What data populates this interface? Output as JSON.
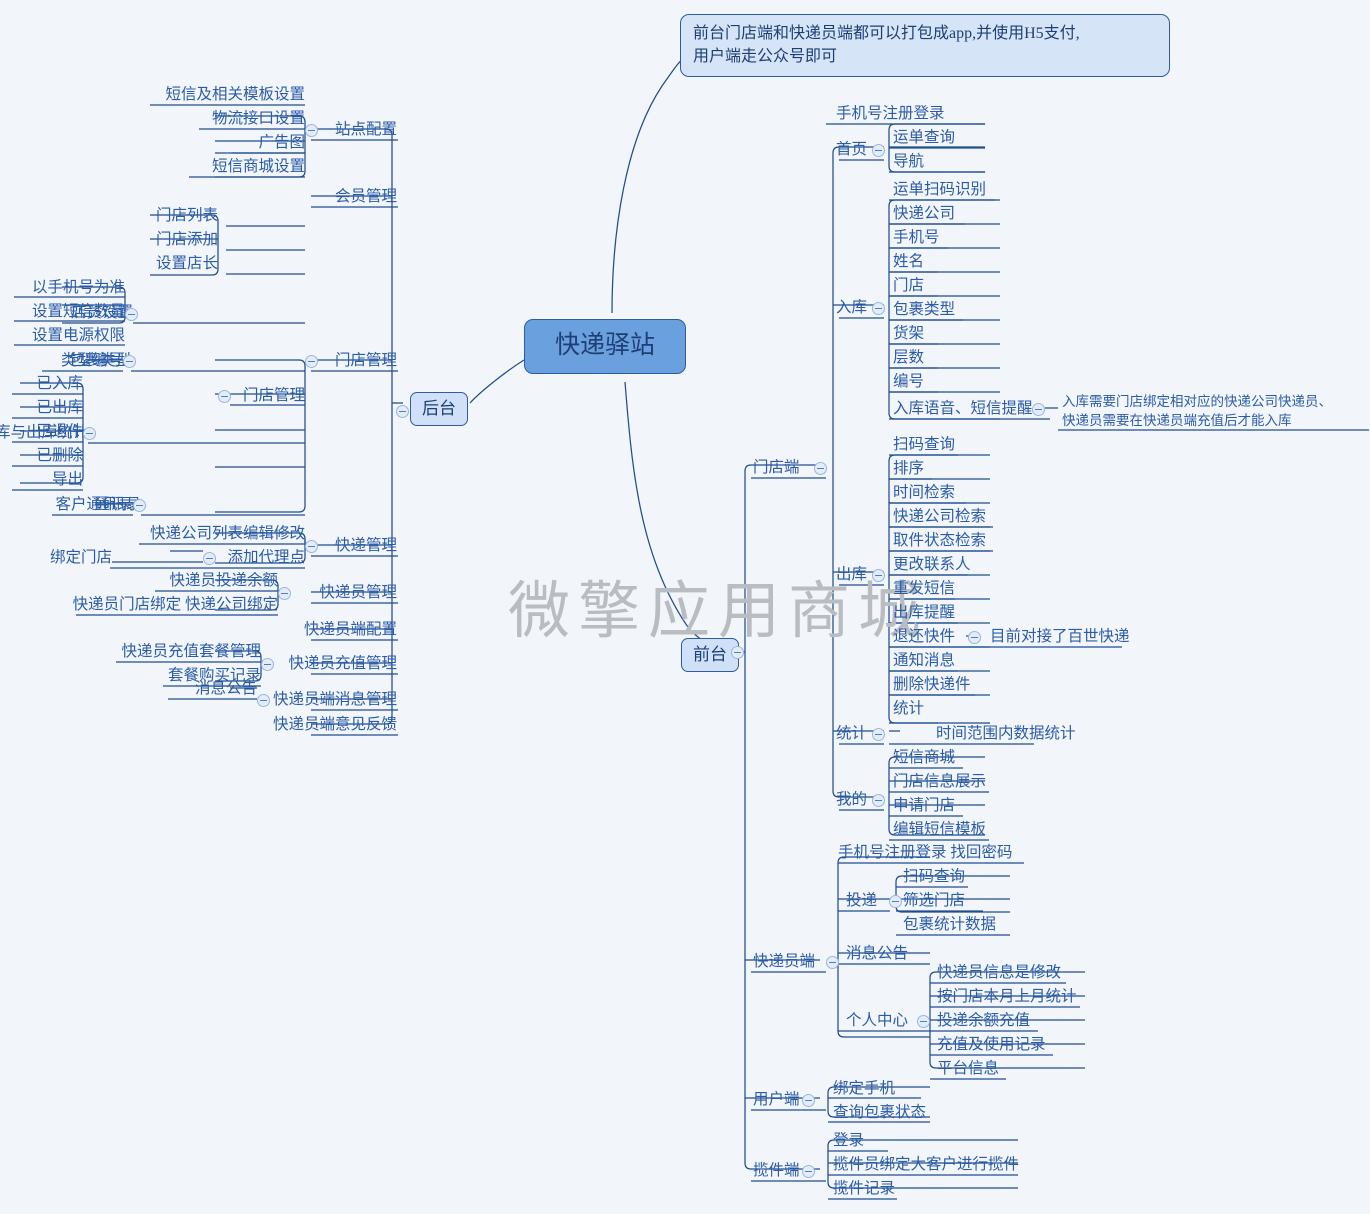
{
  "root": {
    "label": "快递驿站"
  },
  "watermark": {
    "text": "微擎应用商城"
  },
  "colors": {
    "canvas": "#f2f5fa",
    "line": "#1f4e8c",
    "text": "#2b5ca8",
    "root_fill": "#6aa0de",
    "pill_fill": "#cfe0f8",
    "callout_fill": "#d6e4f7",
    "border": "#2f5c9e",
    "watermark": "#b9bcc1"
  },
  "callouts": [
    {
      "id": "note-app",
      "lines": [
        "前台门店端和快递员端都可以打包成app,并使用H5支付,",
        "用户端走公众号即可"
      ]
    }
  ],
  "branches": {
    "backend": {
      "label": "后台",
      "children": [
        {
          "label": "站点配置",
          "children": [
            {
              "label": "短信及相关模板设置"
            },
            {
              "label": "物流接口设置"
            },
            {
              "label": "广告图"
            },
            {
              "label": "短信商城设置"
            }
          ]
        },
        {
          "label": "会员管理",
          "children": []
        },
        {
          "label": "门店管理",
          "children": [
            {
              "label": "门店管理",
              "children": [
                {
                  "label": "门店列表"
                },
                {
                  "label": "门店添加"
                },
                {
                  "label": "设置店长"
                }
              ]
            },
            {
              "label": "店员设置",
              "children": [
                {
                  "label": "以手机号为准"
                },
                {
                  "label": "设置短信数量"
                },
                {
                  "label": "设置电源权限"
                }
              ]
            },
            {
              "label": "包裹类型",
              "children": [
                {
                  "label": "类型编号"
                }
              ]
            },
            {
              "label": "入库与出库统计",
              "children": [
                {
                  "label": "已入库"
                },
                {
                  "label": "已出库"
                },
                {
                  "label": "已退件"
                },
                {
                  "label": "已删除"
                },
                {
                  "label": "导出"
                }
              ]
            },
            {
              "label": "通讯录",
              "children": [
                {
                  "label": "客户通讯录"
                }
              ]
            }
          ]
        },
        {
          "label": "快递管理",
          "children": [
            {
              "label": "快递公司列表编辑修改"
            },
            {
              "label": "添加代理点",
              "children": [
                {
                  "label": "绑定门店"
                }
              ]
            }
          ]
        },
        {
          "label": "快递员管理",
          "children": [
            {
              "label": "快递员投递余额"
            },
            {
              "label": "快递员门店绑定 快递公司绑定"
            }
          ]
        },
        {
          "label": "快递员端配置",
          "children": []
        },
        {
          "label": "快递员充值管理",
          "children": [
            {
              "label": "快递员充值套餐管理"
            },
            {
              "label": "套餐购买记录"
            }
          ]
        },
        {
          "label": "快递员端消息管理",
          "children": [
            {
              "label": "消息公告"
            }
          ]
        },
        {
          "label": "快递员端意见反馈",
          "children": []
        }
      ]
    },
    "frontend": {
      "label": "前台",
      "children": [
        {
          "label": "门店端",
          "children": [
            {
              "label": "首页",
              "children": [
                {
                  "label": "手机号注册登录"
                },
                {
                  "label": "运单查询"
                },
                {
                  "label": "导航"
                }
              ]
            },
            {
              "label": "入库",
              "children": [
                {
                  "label": "运单扫码识别"
                },
                {
                  "label": "快递公司"
                },
                {
                  "label": "手机号"
                },
                {
                  "label": "姓名"
                },
                {
                  "label": "门店"
                },
                {
                  "label": "包裹类型"
                },
                {
                  "label": "货架"
                },
                {
                  "label": "层数"
                },
                {
                  "label": "编号"
                },
                {
                  "label": "入库语音、短信提醒",
                  "note": [
                    "入库需要门店绑定相对应的快递公司快递员、",
                    "快递员需要在快递员端充值后才能入库"
                  ]
                }
              ]
            },
            {
              "label": "出库",
              "children": [
                {
                  "label": "扫码查询"
                },
                {
                  "label": "排序"
                },
                {
                  "label": "时间检索"
                },
                {
                  "label": "快递公司检索"
                },
                {
                  "label": "取件状态检索"
                },
                {
                  "label": "更改联系人"
                },
                {
                  "label": "重发短信"
                },
                {
                  "label": "出库提醒"
                },
                {
                  "label": "退还快件",
                  "note": [
                    "目前对接了百世快递"
                  ]
                },
                {
                  "label": "通知消息"
                },
                {
                  "label": "删除快递件"
                },
                {
                  "label": "统计"
                }
              ]
            },
            {
              "label": "统计",
              "children": [
                {
                  "label": "时间范围内数据统计"
                }
              ]
            },
            {
              "label": "我的",
              "children": [
                {
                  "label": "短信商城"
                },
                {
                  "label": "门店信息展示"
                },
                {
                  "label": "申请门店"
                },
                {
                  "label": "编辑短信模板"
                }
              ]
            }
          ]
        },
        {
          "label": "快递员端",
          "children": [
            {
              "label": "手机号注册登录 找回密码"
            },
            {
              "label": "投递",
              "children": [
                {
                  "label": "扫码查询"
                },
                {
                  "label": "筛选门店"
                },
                {
                  "label": "包裹统计数据"
                }
              ]
            },
            {
              "label": "消息公告"
            },
            {
              "label": "个人中心",
              "children": [
                {
                  "label": "快递员信息是修改"
                },
                {
                  "label": "按门店本月上月统计"
                },
                {
                  "label": "投递余额充值"
                },
                {
                  "label": "充值及使用记录"
                },
                {
                  "label": "平台信息"
                }
              ]
            }
          ]
        },
        {
          "label": "用户端",
          "children": [
            {
              "label": "绑定手机"
            },
            {
              "label": "查询包裹状态"
            }
          ]
        },
        {
          "label": "揽件端",
          "children": [
            {
              "label": "登录"
            },
            {
              "label": "揽件员绑定大客户进行揽件"
            },
            {
              "label": "揽件记录"
            }
          ]
        }
      ]
    }
  }
}
